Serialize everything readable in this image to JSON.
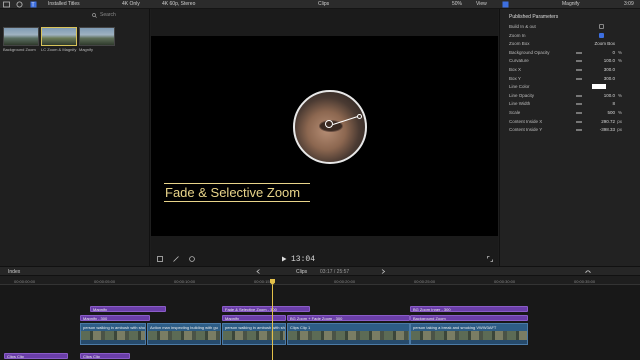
{
  "topbar": {
    "library_title": "Installed Titles",
    "filter": "4K Only",
    "format": "4K 60p, Stereo",
    "clips_label": "Clips",
    "zoom": "50%",
    "view_label": "View",
    "title": "Magnify",
    "duration": "3:09"
  },
  "browser": {
    "search_placeholder": "Search",
    "items": [
      {
        "label": "Background Zoom",
        "color": "#5b6f63"
      },
      {
        "label": "LC Zoom & Magnify",
        "color": "#6b7a56"
      },
      {
        "label": "Magnify",
        "color": "#5e6e58"
      }
    ]
  },
  "viewer": {
    "title_text": "Fade & Selective Zoom",
    "timecode": "13:04"
  },
  "inspector": {
    "header": "Published Parameters",
    "rows": [
      {
        "label": "Build In & out",
        "type": "checkbox",
        "checked": false
      },
      {
        "label": "Zoom In",
        "type": "checkbox",
        "checked": true
      },
      {
        "label": "Zoom Box",
        "type": "popup",
        "value": "Zoom Box"
      },
      {
        "label": "Background Opacity",
        "type": "value",
        "value": "0",
        "unit": "%"
      },
      {
        "label": "Curvature",
        "type": "value",
        "value": "100.0",
        "unit": "%"
      },
      {
        "label": "Box X",
        "type": "value",
        "value": "300.0",
        "unit": ""
      },
      {
        "label": "Box Y",
        "type": "value",
        "value": "300.0",
        "unit": ""
      },
      {
        "label": "Line Color",
        "type": "color",
        "value": ""
      },
      {
        "label": "Line Opacity",
        "type": "value",
        "value": "100.0",
        "unit": "%"
      },
      {
        "label": "Line Width",
        "type": "value",
        "value": "8",
        "unit": ""
      },
      {
        "label": "Scale",
        "type": "value",
        "value": "500",
        "unit": "%"
      },
      {
        "label": "Content Inside X",
        "type": "value",
        "value": "290.72",
        "unit": "px"
      },
      {
        "label": "Content Inside Y",
        "type": "value",
        "value": "-398.33",
        "unit": "px"
      }
    ]
  },
  "timeline": {
    "index_label": "Index",
    "clips_label": "Clips",
    "position": "03:17 / 25:57",
    "ruler": [
      "00:00:00:00",
      "00:00:05:00",
      "00:00:10:00",
      "00:00:15:00",
      "00:00:20:00",
      "00:00:25:00",
      "00:00:30:00",
      "00:00:35:00"
    ],
    "title_clips": [
      {
        "label": "Magnify",
        "row": 0
      },
      {
        "label": "Fade & Selective Zoom - 300",
        "row": 0
      },
      {
        "label": "BG Zoom Inner - 300",
        "row": 0
      },
      {
        "label": "Magnify - 300",
        "row": 1
      },
      {
        "label": "Magnify",
        "row": 1
      },
      {
        "label": "BG Zoom + Fade Zoom - 300",
        "row": 1
      },
      {
        "label": "Background Zoom",
        "row": 1
      }
    ],
    "video_clips": [
      {
        "label": "person walking in ambush with sho"
      },
      {
        "label": "Action man inspecting building with gu"
      },
      {
        "label": "person walking in ambush with sho"
      },
      {
        "label": "Clips Clip 1"
      },
      {
        "label": "person taking a break and smoking VWW3AFT"
      }
    ],
    "bottom_clips": [
      {
        "label": "Clips Clip"
      },
      {
        "label": "Clips Clip"
      }
    ]
  }
}
